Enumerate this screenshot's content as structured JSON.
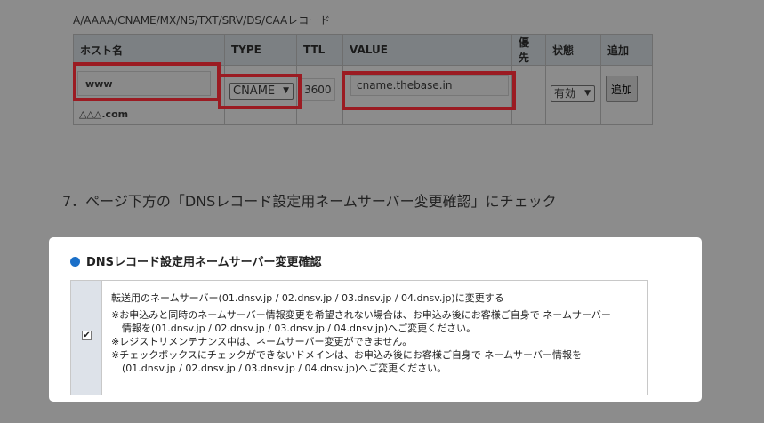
{
  "section_title": "A/AAAA/CNAME/MX/NS/TXT/SRV/DS/CAAレコード",
  "table": {
    "headers": [
      "ホスト名",
      "TYPE",
      "TTL",
      "VALUE",
      "優先",
      "状態",
      "追加"
    ],
    "row": {
      "host": "www",
      "domain": "△△△.com",
      "type": "CNAME",
      "ttl": "3600",
      "value": "cname.thebase.in",
      "priority": "",
      "status": "有効",
      "add_label": "追加"
    }
  },
  "step_text": "7．ページ下方の「DNSレコード設定用ネームサーバー変更確認」にチェック",
  "panel": {
    "title": "DNSレコード設定用ネームサーバー変更確認",
    "checked": true,
    "lines": [
      "転送用のネームサーバー(01.dnsv.jp / 02.dnsv.jp / 03.dnsv.jp / 04.dnsv.jp)に変更する",
      "※お申込みと同時のネームサーバー情報変更を希望されない場合は、お申込み後にお客様ご自身で ネームサーバー",
      "情報を(01.dnsv.jp / 02.dnsv.jp / 03.dnsv.jp / 04.dnsv.jp)へご変更ください。",
      "※レジストリメンテナンス中は、ネームサーバー変更ができません。",
      "※チェックボックスにチェックができないドメインは、お申込み後にお客様ご自身で ネームサーバー情報を",
      "(01.dnsv.jp / 02.dnsv.jp / 03.dnsv.jp / 04.dnsv.jp)へご変更ください。"
    ]
  },
  "colors": {
    "highlight": "#9b1b22",
    "overlay": "#8c8c8c",
    "accent": "#1a6fc8"
  }
}
